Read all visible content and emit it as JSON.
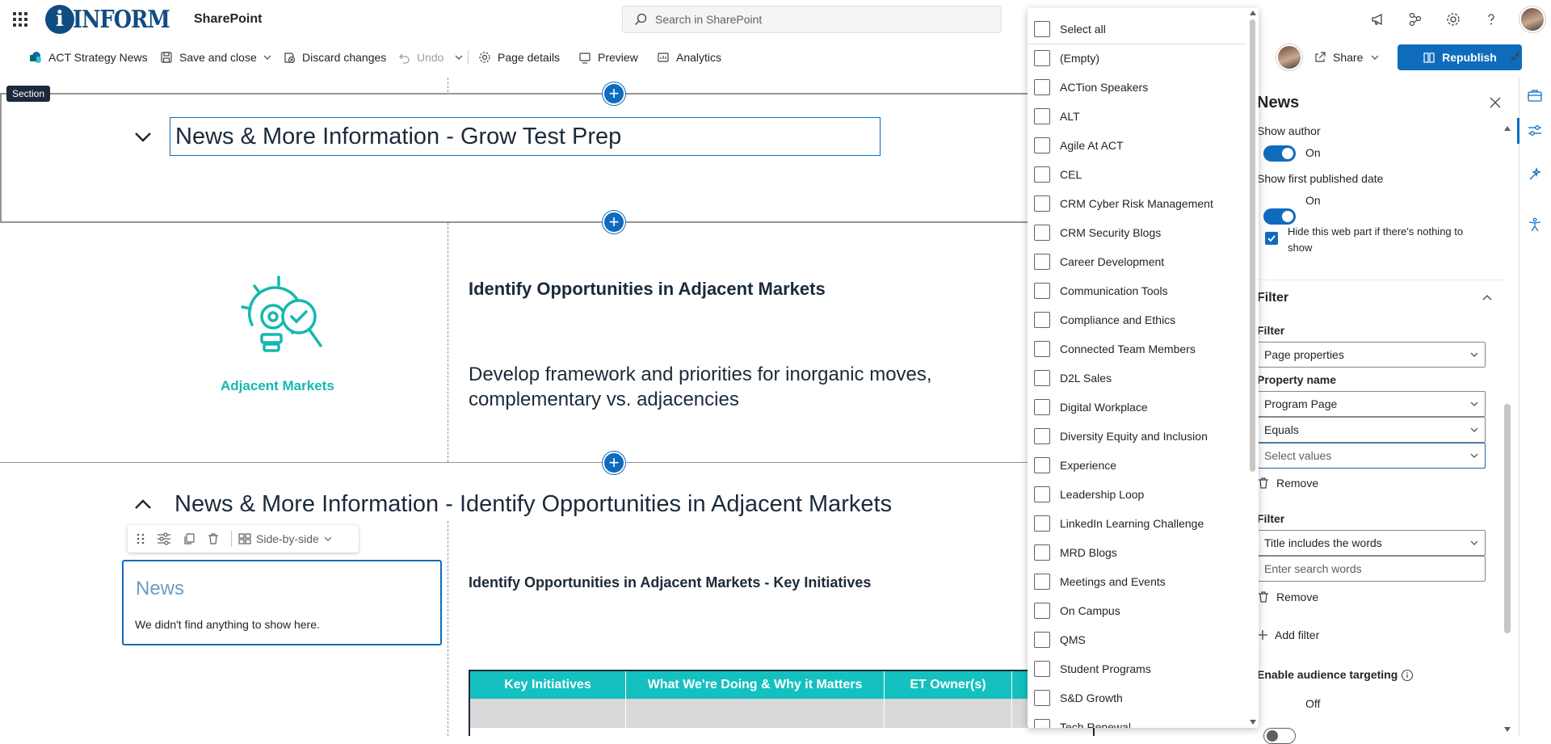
{
  "topbar": {
    "logo_letter": "i",
    "logo_word": "INFORM",
    "app_name": "SharePoint",
    "search_placeholder": "Search in SharePoint"
  },
  "commandbar": {
    "site_name": "ACT Strategy News",
    "save_close": "Save and close",
    "discard": "Discard changes",
    "undo": "Undo",
    "page_details": "Page details",
    "preview": "Preview",
    "analytics": "Analytics",
    "share": "Share",
    "republish": "Republish"
  },
  "canvas": {
    "section_tag": "Section",
    "section1_title": "News & More Information - Grow Test Prep",
    "adjacent_label": "Adjacent Markets",
    "identify_heading": "Identify Opportunities in Adjacent Markets",
    "develop_text": "Develop framework and priorities for inorganic moves, complementary vs. adjacencies",
    "section3_title": "News & More Information - Identify Opportunities in Adjacent Markets",
    "layout_label": "Side-by-side",
    "news_title": "News",
    "news_empty": "We didn't find anything to show here.",
    "key_initiatives_title": "Identify Opportunities in Adjacent Markets - Key Initiatives",
    "table_headers": [
      "Key Initiatives",
      "What We're Doing & Why it Matters",
      "ET Owner(s)"
    ]
  },
  "dropdown": {
    "items": [
      "Select all",
      "(Empty)",
      "ACTion Speakers",
      "ALT",
      "Agile At ACT",
      "CEL",
      "CRM Cyber Risk Management",
      "CRM Security Blogs",
      "Career Development",
      "Communication Tools",
      "Compliance and Ethics",
      "Connected Team Members",
      "D2L Sales",
      "Digital Workplace",
      "Diversity Equity and Inclusion",
      "Experience",
      "Leadership Loop",
      "LinkedIn Learning Challenge",
      "MRD Blogs",
      "Meetings and Events",
      "On Campus",
      "QMS",
      "Student Programs",
      "S&D Growth",
      "Tech Renewal"
    ]
  },
  "pane": {
    "title": "News",
    "show_author": "Show author",
    "show_author_state": "On",
    "show_first_published": "Show first published date",
    "show_first_published_state": "On",
    "hide_webpart": "Hide this web part if there's nothing to show",
    "filter_section": "Filter",
    "filter_label": "Filter",
    "filter_value": "Page properties",
    "property_name_label": "Property name",
    "property_name_value": "Program Page",
    "operator_value": "Equals",
    "values_placeholder": "Select values",
    "remove": "Remove",
    "filter2_label": "Filter",
    "filter2_value": "Title includes the words",
    "search_words_placeholder": "Enter search words",
    "remove2": "Remove",
    "add_filter": "Add filter",
    "audience_targeting": "Enable audience targeting",
    "audience_state": "Off"
  },
  "colors": {
    "accent": "#0f6cbd",
    "teal": "#14c0c0",
    "navy": "#1b2a3a"
  }
}
